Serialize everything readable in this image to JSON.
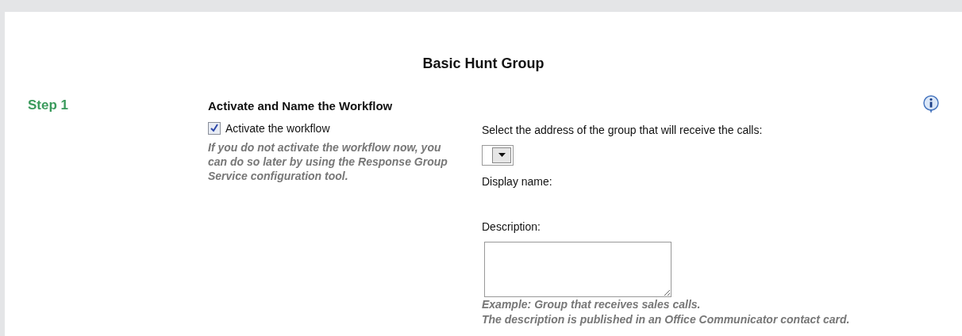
{
  "title": "Basic Hunt Group",
  "step": {
    "label": "Step 1",
    "heading": "Activate and Name the Workflow"
  },
  "activate": {
    "label": "Activate the workflow",
    "checked": true,
    "note": "If you do not activate the workflow now, you can do so later by using the Response Group Service configuration tool."
  },
  "address": {
    "label": "Select the address of the group that will receive the calls:"
  },
  "display_name": {
    "label": "Display name:"
  },
  "description": {
    "label": "Description:",
    "hints": [
      "Example: Group that receives sales calls.",
      "The description is published in an Office Communicator contact card."
    ]
  }
}
